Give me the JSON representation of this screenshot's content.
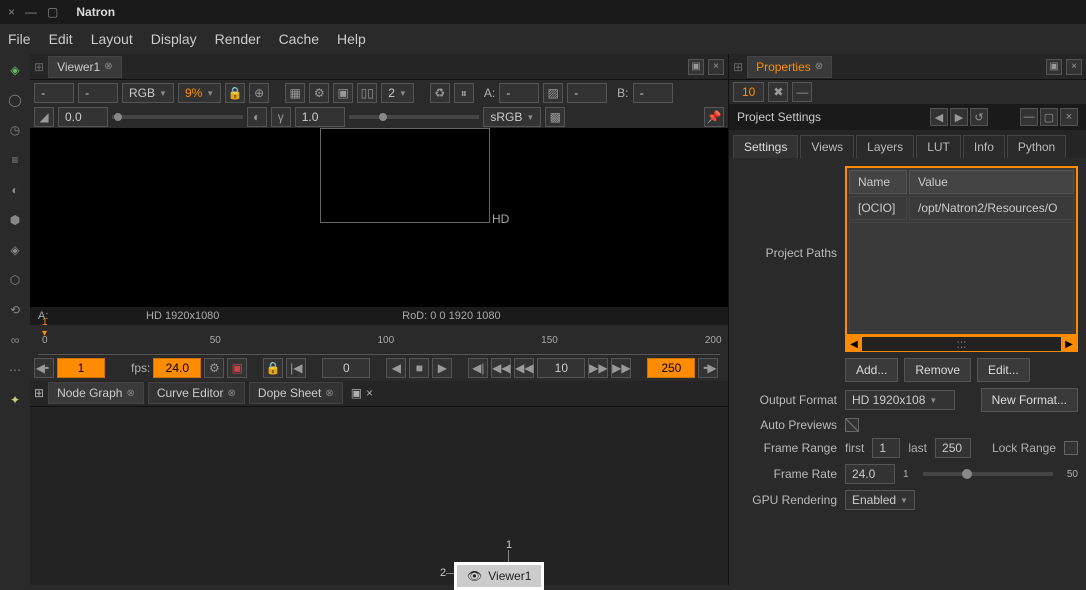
{
  "window": {
    "title": "Natron"
  },
  "menu": {
    "file": "File",
    "edit": "Edit",
    "layout": "Layout",
    "display": "Display",
    "render": "Render",
    "cache": "Cache",
    "help": "Help"
  },
  "viewer": {
    "tab": "Viewer1",
    "layer_a": "-",
    "channel_a": "-",
    "channels": "RGB",
    "zoom": "9%",
    "fit_label": "2",
    "input_a_label": "A:",
    "input_a": "-",
    "input_a2": "-",
    "input_b_label": "B:",
    "input_b": "-",
    "gain": "0.0",
    "gamma": "1.0",
    "colorspace": "sRGB",
    "hd_tag": "HD",
    "info_a": "A:",
    "info_format": "HD 1920x1080",
    "info_rod": "RoD: 0 0 1920 1080",
    "marker": "1",
    "ticks": [
      "0",
      "50",
      "100",
      "150",
      "200"
    ],
    "in_frame": "1",
    "fps_label": "fps:",
    "fps": "24.0",
    "cur_frame": "0",
    "incr": "10",
    "out_frame": "250"
  },
  "nodegraph": {
    "tabs": [
      "Node Graph",
      "Curve Editor",
      "Dope Sheet"
    ],
    "node_name": "Viewer1",
    "port1": "1",
    "port2": "2"
  },
  "properties": {
    "tab": "Properties",
    "max_panels": "10",
    "project_settings": "Project Settings",
    "tabs": [
      "Settings",
      "Views",
      "Layers",
      "LUT",
      "Info",
      "Python"
    ],
    "table": {
      "name_hdr": "Name",
      "value_hdr": "Value",
      "row1_name": "[OCIO]",
      "row1_value": "/opt/Natron2/Resources/O"
    },
    "project_paths_label": "Project Paths",
    "scroll_hint": ":::",
    "add": "Add...",
    "remove": "Remove",
    "edit": "Edit...",
    "output_format_label": "Output Format",
    "output_format": "HD 1920x108",
    "new_format": "New Format...",
    "auto_previews_label": "Auto Previews",
    "frame_range_label": "Frame Range",
    "first_label": "first",
    "first": "1",
    "last_label": "last",
    "last": "250",
    "lock_range_label": "Lock Range",
    "frame_rate_label": "Frame Rate",
    "frame_rate": "24.0",
    "slider_min": "1",
    "slider_max": "50",
    "gpu_label": "GPU Rendering",
    "gpu_value": "Enabled"
  }
}
